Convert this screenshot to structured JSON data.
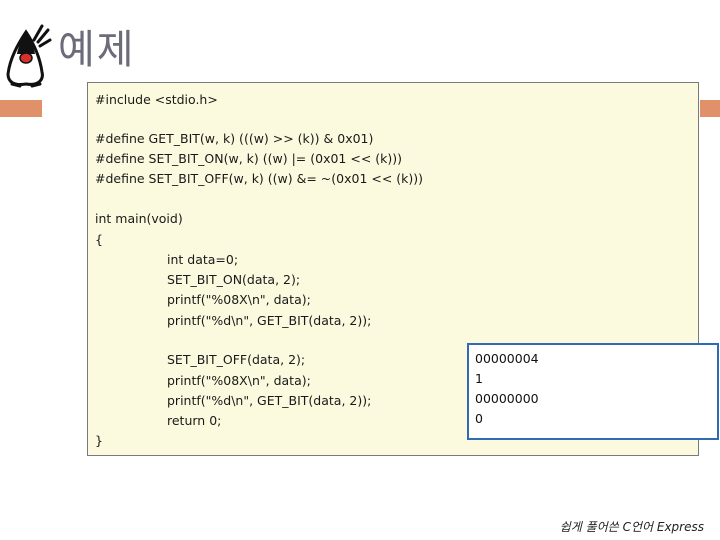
{
  "slide": {
    "title": "예제",
    "footer": "쉽게 풀어쓴 C언어 Express"
  },
  "code": [
    "#include <stdio.h>",
    "",
    "#define GET_BIT(w, k) (((w) >> (k)) & 0x01)",
    "#define SET_BIT_ON(w, k) ((w) |= (0x01 << (k)))",
    "#define SET_BIT_OFF(w, k) ((w) &= ~(0x01 << (k)))",
    "",
    "int main(void)",
    "{",
    "int data=0;",
    "SET_BIT_ON(data, 2);",
    "printf(\"%08X\\n\", data);",
    "printf(\"%d\\n\", GET_BIT(data, 2));",
    "",
    "SET_BIT_OFF(data, 2);",
    "printf(\"%08X\\n\", data);",
    "printf(\"%d\\n\", GET_BIT(data, 2));",
    "return 0;",
    "}"
  ],
  "output": [
    "00000004",
    "1",
    "00000000",
    "0"
  ],
  "colors": {
    "accent_bar": "#e0916a",
    "code_background": "#fcfade",
    "output_border": "#2f6bb3",
    "title_color": "#6b6b7a"
  },
  "icons": {
    "logo": "duke-mascot-icon"
  }
}
